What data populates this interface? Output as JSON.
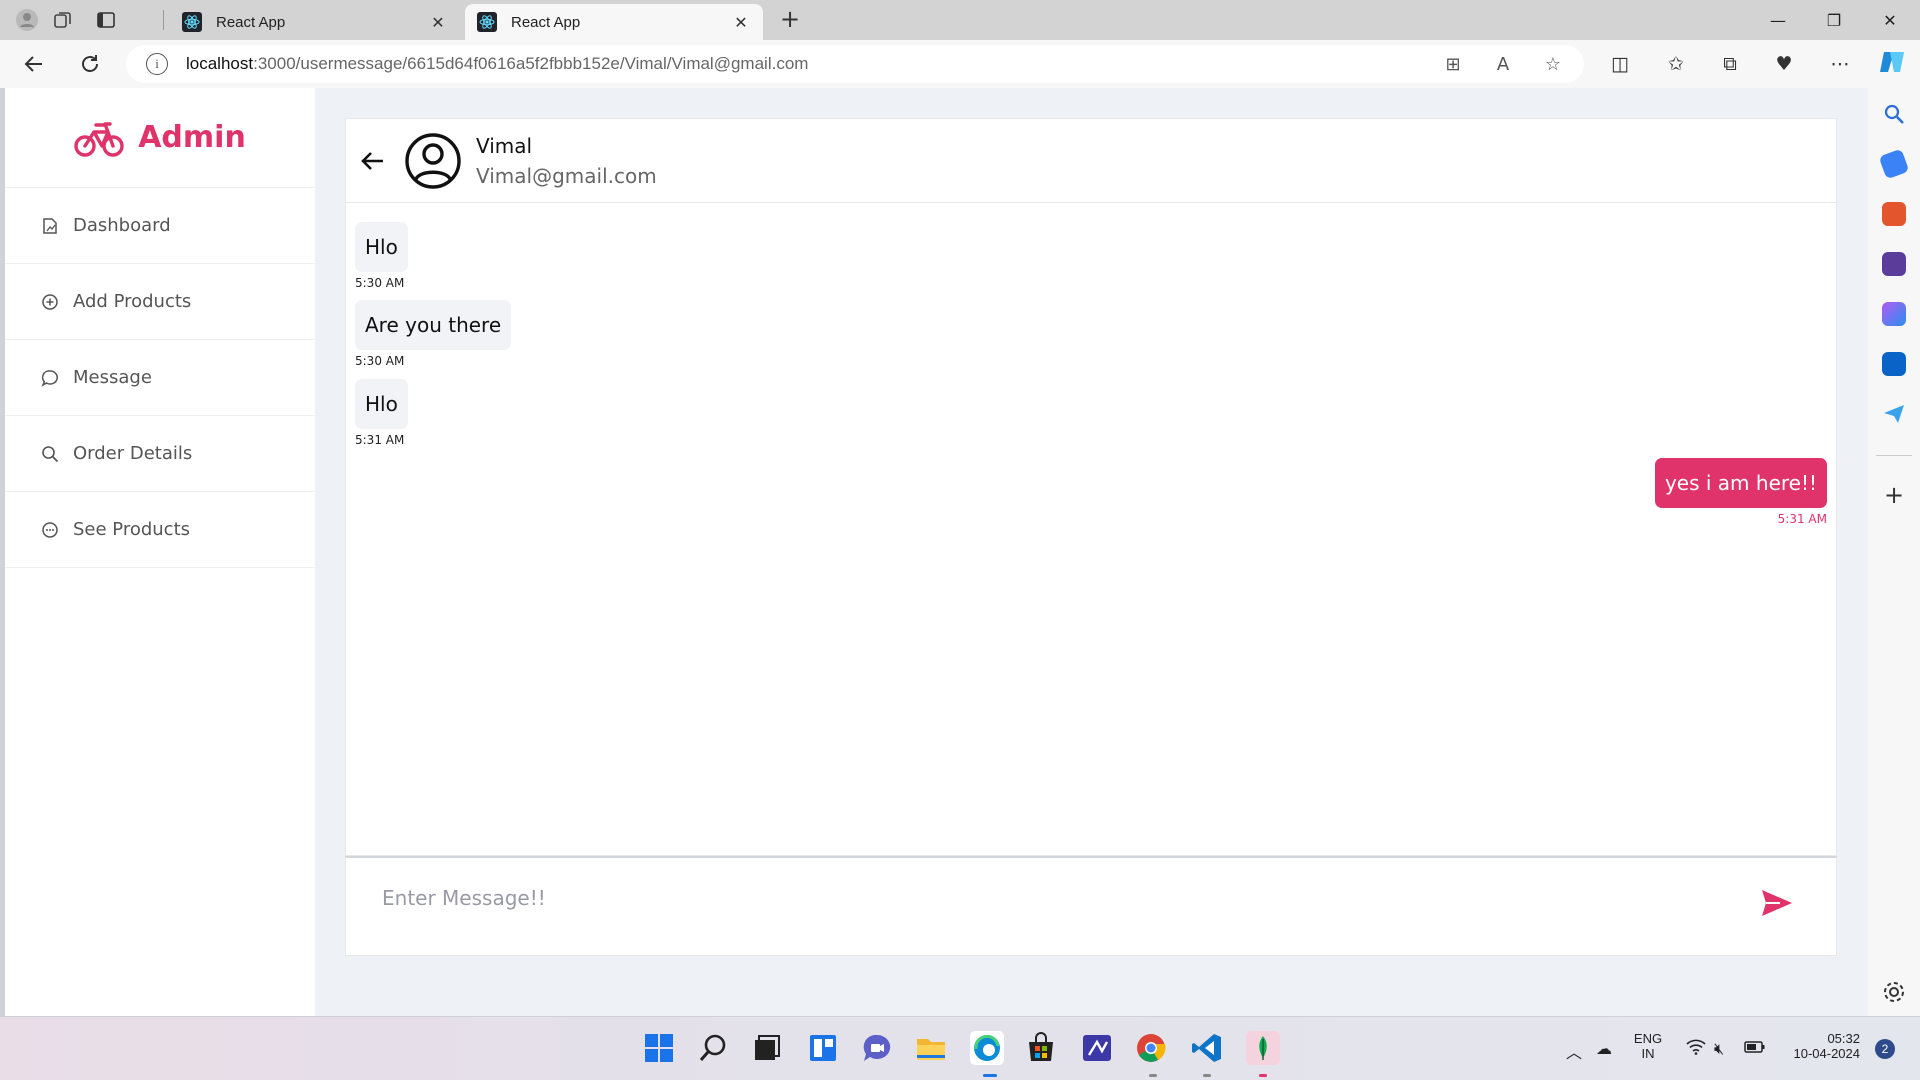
{
  "browser": {
    "tabs": [
      {
        "title": "React App",
        "active": false
      },
      {
        "title": "React App",
        "active": true
      }
    ],
    "url_host": "localhost",
    "url_rest": ":3000/usermessage/6615d64f0616a5f2fbbb152e/Vimal/Vimal@gmail.com"
  },
  "sidebar": {
    "brand": "Admin",
    "items": [
      {
        "label": "Dashboard",
        "icon": "dashboard-icon"
      },
      {
        "label": "Add Products",
        "icon": "plus-circle-icon"
      },
      {
        "label": "Message",
        "icon": "chat-bubble-icon"
      },
      {
        "label": "Order Details",
        "icon": "search-icon"
      },
      {
        "label": "See Products",
        "icon": "more-circle-icon"
      }
    ]
  },
  "chat": {
    "name": "Vimal",
    "email": "Vimal@gmail.com",
    "messages": [
      {
        "text": "Hlo",
        "time": "5:30 AM",
        "mine": false
      },
      {
        "text": "Are you there",
        "time": "5:30 AM",
        "mine": false
      },
      {
        "text": "Hlo",
        "time": "5:31 AM",
        "mine": false
      },
      {
        "text": "yes i am here!!",
        "time": "5:31 AM",
        "mine": true
      }
    ],
    "input_placeholder": "Enter Message!!"
  },
  "taskbar": {
    "lang_top": "ENG",
    "lang_bottom": "IN",
    "time": "05:32",
    "date": "10-04-2024",
    "notification_count": "2"
  },
  "colors": {
    "accent": "#e0336b",
    "bubble_in": "#f1f3f6",
    "page_bg": "#eef1f6"
  }
}
